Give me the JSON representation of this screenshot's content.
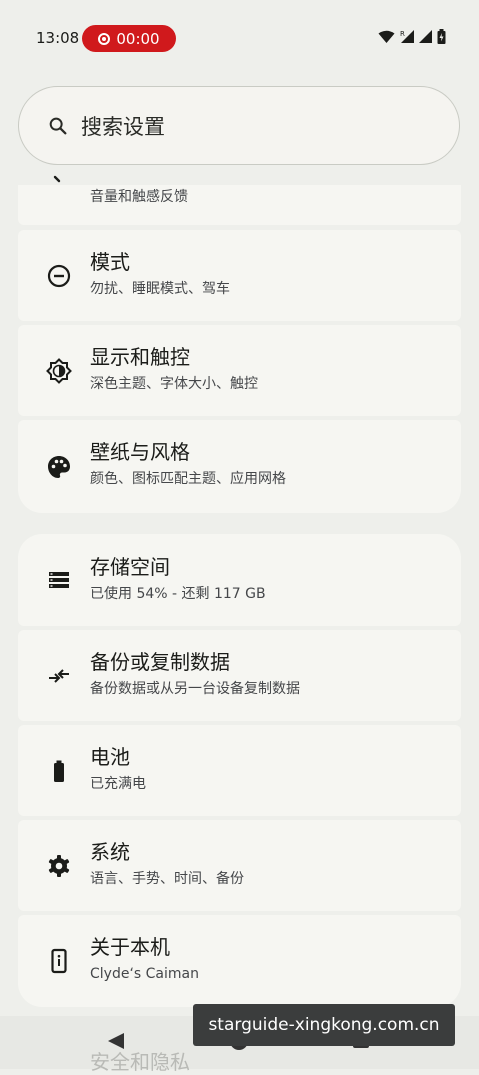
{
  "status_bar": {
    "time": "13:08",
    "recording_timer": "00:00"
  },
  "search": {
    "placeholder": "搜索设置"
  },
  "partial_item": {
    "subtitle": "音量和触感反馈"
  },
  "group1": [
    {
      "icon": "do-not-disturb-icon",
      "title": "模式",
      "subtitle": "勿扰、睡眠模式、驾车"
    },
    {
      "icon": "display-brightness-icon",
      "title": "显示和触控",
      "subtitle": "深色主题、字体大小、触控"
    },
    {
      "icon": "palette-icon",
      "title": "壁纸与风格",
      "subtitle": "颜色、图标匹配主题、应用网格"
    }
  ],
  "group2": [
    {
      "icon": "storage-icon",
      "title": "存储空间",
      "subtitle": "已使用 54% - 还剩 117 GB"
    },
    {
      "icon": "backup-transfer-icon",
      "title": "备份或复制数据",
      "subtitle": "备份数据或从另一台设备复制数据"
    },
    {
      "icon": "battery-icon",
      "title": "电池",
      "subtitle": "已充满电"
    },
    {
      "icon": "gear-icon",
      "title": "系统",
      "subtitle": "语言、手势、时间、备份"
    },
    {
      "icon": "device-info-icon",
      "title": "关于本机",
      "subtitle": "Clyde‘s Caiman"
    }
  ],
  "next_item_peek": "安全和隐私",
  "watermark": "starguide-xingkong.com.cn"
}
